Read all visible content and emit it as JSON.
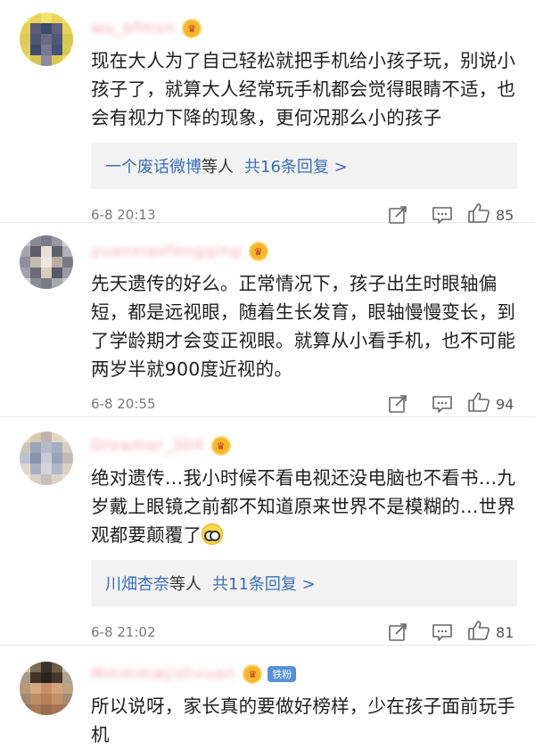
{
  "comments": [
    {
      "username": "wu_bfmsn",
      "text": "现在大人为了自己轻松就把手机给小孩子玩，别说小孩子了，就算大人经常玩手机都会觉得眼睛不适，也会有视力下降的现象，更何况那么小的孩子",
      "reply_users": "一个废话微博",
      "reply_tail": "等人",
      "reply_count": "共16条回复 >",
      "time": "6-8 20:13",
      "likes": "85",
      "avatar_colors": [
        "#f0e060",
        "#e8d55a",
        "#f2e36c",
        "#ead658",
        "#f1e466",
        "#e3cf52",
        "#5a5a78",
        "#3e4a6a",
        "#62607c",
        "#e6d25a",
        "#dccb56",
        "#4a5878",
        "#6d6a86",
        "#50587a",
        "#d8c654",
        "#e0cf58",
        "#404a6c",
        "#7a7790",
        "#485274",
        "#dcc955",
        "#ece05e",
        "#d5c454",
        "#8a8aa0",
        "#d9c853",
        "#efe162"
      ]
    },
    {
      "username": "yuanxiaofengqing",
      "text": "先天遗传的好么。正常情况下，孩子出生时眼轴偏短，都是远视眼，随着生长发育，眼轴慢慢变长，到了学龄期才会变正视眼。就算从小看手机，也不可能两岁半就900度近视的。",
      "time": "6-8 20:55",
      "likes": "94",
      "avatar_colors": [
        "#c8c8cc",
        "#8a8a94",
        "#7c7c88",
        "#9a9aa4",
        "#d0d0d4",
        "#a4a4ae",
        "#5c5c68",
        "#e8e0d8",
        "#606070",
        "#b0b0b8",
        "#90909c",
        "#c8bcb0",
        "#f0e8e0",
        "#b8aca0",
        "#7a7a86",
        "#a0a0aa",
        "#6a6a78",
        "#d8ccc0",
        "#585866",
        "#9a9aa4",
        "#d4d4d8",
        "#8c8c96",
        "#7a7a84",
        "#a8a8b0",
        "#cacace"
      ]
    },
    {
      "username": "Dreamer_304",
      "text": "绝对遗传…我小时候不看电视还没电脑也不看书…九岁戴上眼镜之前都不知道原来世界不是模糊的…世界观都要颠覆了",
      "reply_users": "川畑杏奈",
      "reply_tail": "等人",
      "reply_count": "共11条回复 >",
      "time": "6-8 21:02",
      "likes": "81",
      "avatar_colors": [
        "#e8dcc8",
        "#d8c8b0",
        "#c0b4a8",
        "#e2d6c4",
        "#eee4d4",
        "#cfc4b8",
        "#9aa4b8",
        "#b4bccc",
        "#a6aec0",
        "#d8ccbc",
        "#bcc4d4",
        "#8894ac",
        "#c8ccd8",
        "#98a2b8",
        "#c4bcb4",
        "#e0d8cc",
        "#a8b0c4",
        "#d4d4dc",
        "#b0b8c8",
        "#dcd0c0",
        "#efe6d8",
        "#d8d0c8",
        "#c6c0bc",
        "#dcd4cc",
        "#eae2d6"
      ]
    },
    {
      "username": "Mmmmwjishvuan",
      "fan_badge": "铁粉",
      "text": "所以说呀，家长真的要做好榜样，少在孩子面前玩手机",
      "avatar_colors": [
        "#c8c0b0",
        "#7a6a58",
        "#3a3028",
        "#6c5c4a",
        "#d0c8b8",
        "#a89a88",
        "#403428",
        "#2a221c",
        "#46392c",
        "#b0a290",
        "#b89878",
        "#d8a880",
        "#c89068",
        "#d6a47c",
        "#c0a084",
        "#a08870",
        "#c08c64",
        "#b88058",
        "#c4906a",
        "#a48c74",
        "#8a7864",
        "#a87856",
        "#9c6e4e",
        "#a67654",
        "#8e7c68"
      ]
    }
  ]
}
